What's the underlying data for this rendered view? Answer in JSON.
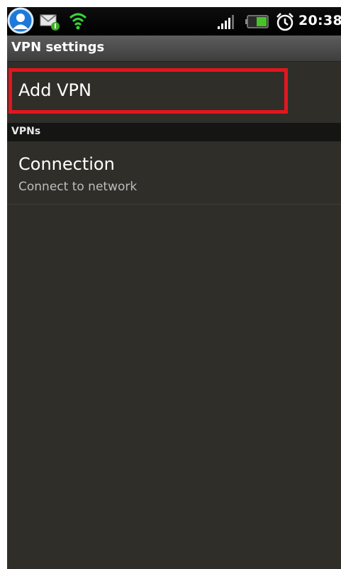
{
  "status_bar": {
    "time": "20:38",
    "icons": [
      "avatar-icon",
      "message-icon",
      "wifi-icon",
      "signal-icon",
      "battery-icon",
      "alarm-icon"
    ]
  },
  "title_bar": {
    "title": "VPN settings"
  },
  "list": {
    "add_vpn_label": "Add VPN",
    "section_header": "VPNs",
    "connection": {
      "title": "Connection",
      "subtitle": "Connect to network"
    }
  },
  "colors": {
    "background": "#2f2e29",
    "highlight": "#e3161d",
    "status_bar": "#000000",
    "section_header": "#151514"
  }
}
